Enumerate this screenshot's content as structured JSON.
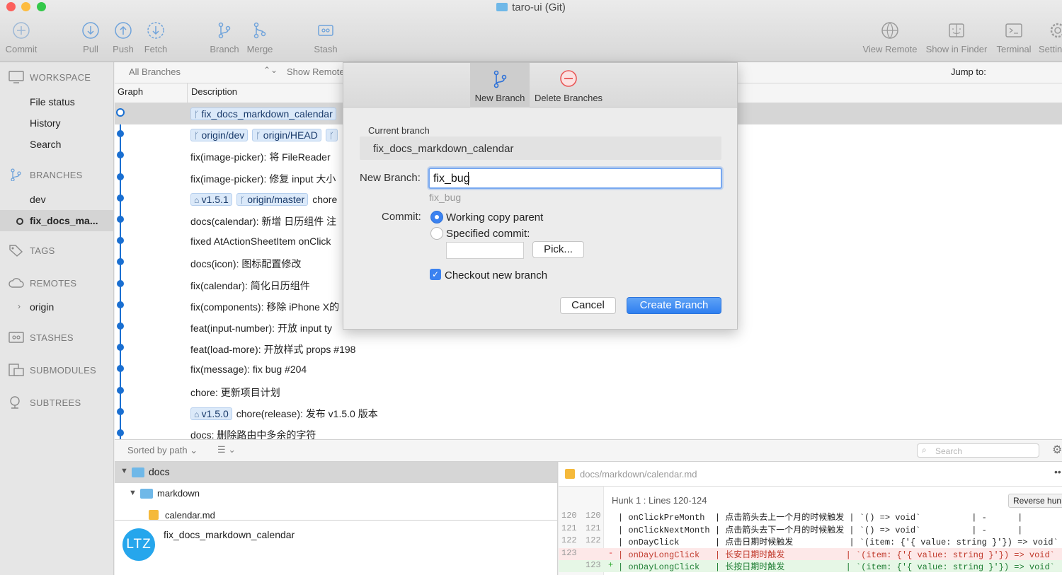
{
  "window": {
    "title": "taro-ui (Git)"
  },
  "toolbar": {
    "commit": "Commit",
    "pull": "Pull",
    "push": "Push",
    "fetch": "Fetch",
    "branch": "Branch",
    "merge": "Merge",
    "stash": "Stash",
    "view_remote": "View Remote",
    "show_in_finder": "Show in Finder",
    "terminal": "Terminal",
    "settings": "Settin"
  },
  "sidebar": {
    "workspace": "WORKSPACE",
    "file_status": "File status",
    "history": "History",
    "search": "Search",
    "branches": "BRANCHES",
    "branch_dev": "dev",
    "branch_current": "fix_docs_ma...",
    "tags": "TAGS",
    "remotes": "REMOTES",
    "origin": "origin",
    "stashes": "STASHES",
    "submodules": "SUBMODULES",
    "subtrees": "SUBTREES"
  },
  "graph_header": {
    "branch_filter": "All Branches",
    "show_remote": "Show Remote",
    "jump_to": "Jump to:",
    "col_graph": "Graph",
    "col_description": "Description"
  },
  "commits": [
    {
      "tags": [
        "fix_docs_markdown_calendar"
      ],
      "text": ""
    },
    {
      "tags": [
        "origin/dev",
        "origin/HEAD",
        ""
      ],
      "text": ""
    },
    {
      "tags": [],
      "text": "fix(image-picker): 将 FileReader"
    },
    {
      "tags": [],
      "text": "fix(image-picker): 修复 input 大小"
    },
    {
      "tags": [
        "v1.5.1",
        "origin/master"
      ],
      "text": "chore"
    },
    {
      "tags": [],
      "text": "docs(calendar): 新增 日历组件 注"
    },
    {
      "tags": [],
      "text": "fixed AtActionSheetItem onClick"
    },
    {
      "tags": [],
      "text": "docs(icon): 图标配置修改"
    },
    {
      "tags": [],
      "text": "fix(calendar): 简化日历组件"
    },
    {
      "tags": [],
      "text": "fix(components): 移除 iPhone X的"
    },
    {
      "tags": [],
      "text": "feat(input-number): 开放 input ty"
    },
    {
      "tags": [],
      "text": "feat(load-more): 开放样式 props #198"
    },
    {
      "tags": [],
      "text": "fix(message): fix bug #204"
    },
    {
      "tags": [],
      "text": "chore: 更新项目计划"
    },
    {
      "tags": [
        "v1.5.0"
      ],
      "text": "chore(release): 发布 v1.5.0 版本"
    },
    {
      "tags": [],
      "text": "docs: 删除路由中多余的字符"
    }
  ],
  "bottom_bar": {
    "sort": "Sorted by path",
    "search_placeholder": "Search"
  },
  "files": {
    "folder_docs": "docs",
    "folder_markdown": "markdown",
    "file_calendar": "calendar.md",
    "author_initials": "LTZ",
    "commit_branch": "fix_docs_markdown_calendar"
  },
  "diff": {
    "file_path": "docs/markdown/calendar.md",
    "hunk_title": "Hunk 1 : Lines 120-124",
    "reverse_button": "Reverse hun",
    "lines": [
      {
        "old": "120",
        "new": "120",
        "type": "ctx",
        "text": "| onClickPreMonth  | 点击箭头去上一个月的时候触发 | `() => void`          | -      |"
      },
      {
        "old": "121",
        "new": "121",
        "type": "ctx",
        "text": "| onClickNextMonth | 点击箭头去下一个月的时候触发 | `() => void`          | -      |"
      },
      {
        "old": "122",
        "new": "122",
        "type": "ctx",
        "text": "| onDayClick       | 点击日期时候触发           | `(item: {'{ value: string }'}) => void`"
      },
      {
        "old": "123",
        "new": "",
        "type": "del",
        "text": "| onDayLongClick   | 长安日期时触发            | `(item: {'{ value: string }'}) => void`"
      },
      {
        "old": "",
        "new": "123",
        "type": "add",
        "text": "| onDayLongClick   | 长按日期时触发            | `(item: {'{ value: string }'}) => void`"
      }
    ]
  },
  "dialog": {
    "tab_new_branch": "New Branch",
    "tab_delete_branches": "Delete Branches",
    "current_branch_label": "Current branch",
    "current_branch_value": "fix_docs_markdown_calendar",
    "new_branch_label": "New Branch:",
    "new_branch_value": "fix_bug",
    "new_branch_hint": "fix_bug",
    "commit_label": "Commit:",
    "option_working_copy": "Working copy parent",
    "option_specified": "Specified commit:",
    "pick_button": "Pick...",
    "checkout_label": "Checkout new branch",
    "cancel_button": "Cancel",
    "create_button": "Create Branch"
  },
  "colors": {
    "accent": "#3b82f0",
    "graph_line": "#1a6fd1",
    "deleted_bg": "#fde8e8",
    "added_bg": "#e6f7e6"
  }
}
